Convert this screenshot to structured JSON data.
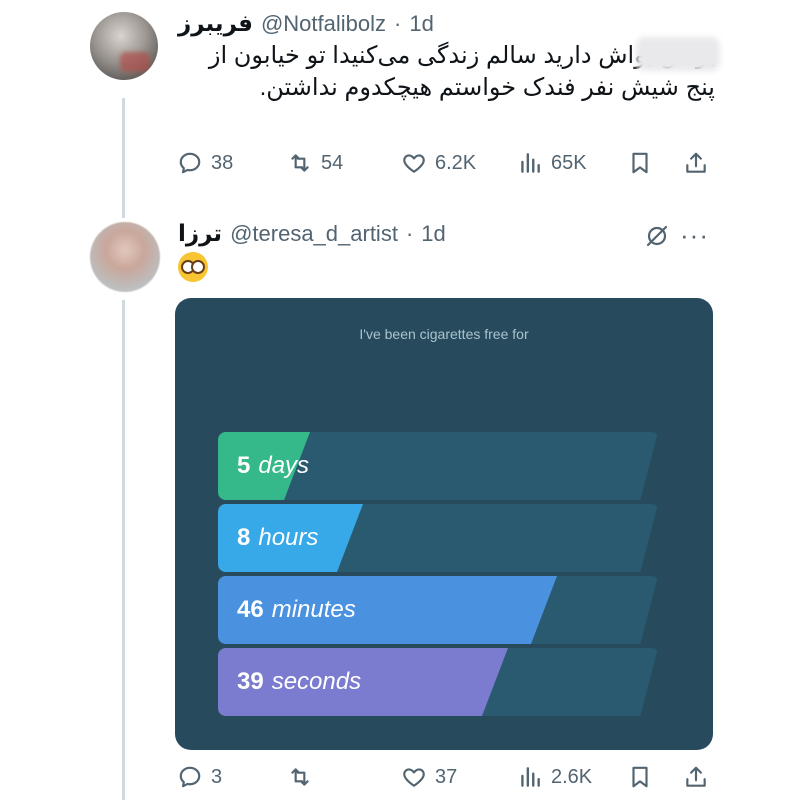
{
  "tweet1": {
    "display_name": "فریبرز",
    "handle": "@Notfalibolz",
    "separator": "·",
    "time": "1d",
    "text": "یواش یواش دارید سالم زندگی می‌کنیدا تو خیابون از پنج شیش نفر فندک خواستم هیچکدوم نداشتن.",
    "actions": {
      "replies": "38",
      "retweets": "54",
      "likes": "6.2K",
      "views": "65K"
    }
  },
  "tweet2": {
    "display_name": "ترزا",
    "handle": "@teresa_d_artist",
    "separator": "·",
    "time": "1d",
    "emoji": "nerd-face-emoji",
    "actions": {
      "replies": "3",
      "retweets": "",
      "likes": "37",
      "views": "2.6K"
    }
  },
  "card": {
    "caption": "I've been cigarettes free for",
    "rows": [
      {
        "value": "5",
        "unit": "days",
        "fill": 0.21,
        "color": "#35b98a"
      },
      {
        "value": "8",
        "unit": "hours",
        "fill": 0.33,
        "color": "#38a9e8"
      },
      {
        "value": "46",
        "unit": "minutes",
        "fill": 0.77,
        "color": "#4a92e0"
      },
      {
        "value": "39",
        "unit": "seconds",
        "fill": 0.66,
        "color": "#7b7ccf"
      }
    ]
  },
  "colors": {
    "muted": "#536471",
    "text": "#0f1419",
    "card_bg": "#274b5c"
  }
}
